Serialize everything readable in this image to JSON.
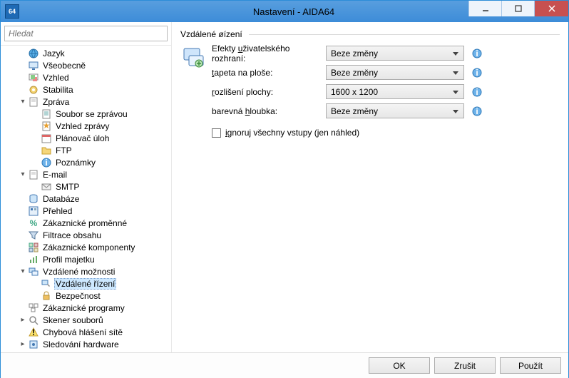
{
  "window": {
    "title": "Nastavení - AIDA64",
    "app_icon_text": "64"
  },
  "search": {
    "placeholder": "Hledat"
  },
  "tree": [
    {
      "label": "Jazyk",
      "icon": "globe",
      "indent": 1,
      "toggle": "none"
    },
    {
      "label": "Všeobecně",
      "icon": "monitor",
      "indent": 1,
      "toggle": "none"
    },
    {
      "label": "Vzhled",
      "icon": "palette",
      "indent": 1,
      "toggle": "none"
    },
    {
      "label": "Stabilita",
      "icon": "gear-yellow",
      "indent": 1,
      "toggle": "none"
    },
    {
      "label": "Zpráva",
      "icon": "page",
      "indent": 1,
      "toggle": "open"
    },
    {
      "label": "Soubor se zprávou",
      "icon": "page-lines",
      "indent": 2,
      "toggle": "none"
    },
    {
      "label": "Vzhled zprávy",
      "icon": "page-star",
      "indent": 2,
      "toggle": "none"
    },
    {
      "label": "Plánovač úloh",
      "icon": "calendar",
      "indent": 2,
      "toggle": "none"
    },
    {
      "label": "FTP",
      "icon": "folder",
      "indent": 2,
      "toggle": "none"
    },
    {
      "label": "Poznámky",
      "icon": "info-blue",
      "indent": 2,
      "toggle": "none"
    },
    {
      "label": "E-mail",
      "icon": "page",
      "indent": 1,
      "toggle": "open"
    },
    {
      "label": "SMTP",
      "icon": "envelope",
      "indent": 2,
      "toggle": "none"
    },
    {
      "label": "Databáze",
      "icon": "db",
      "indent": 1,
      "toggle": "none"
    },
    {
      "label": "Přehled",
      "icon": "summary",
      "indent": 1,
      "toggle": "none"
    },
    {
      "label": "Zákaznické proměnné",
      "icon": "vars",
      "indent": 1,
      "toggle": "none"
    },
    {
      "label": "Filtrace obsahu",
      "icon": "funnel",
      "indent": 1,
      "toggle": "none"
    },
    {
      "label": "Zákaznické komponenty",
      "icon": "components",
      "indent": 1,
      "toggle": "none"
    },
    {
      "label": "Profil majetku",
      "icon": "chart",
      "indent": 1,
      "toggle": "none"
    },
    {
      "label": "Vzdálené možnosti",
      "icon": "remote",
      "indent": 1,
      "toggle": "open"
    },
    {
      "label": "Vzdálené řízení",
      "icon": "remote-ctrl",
      "indent": 2,
      "toggle": "none",
      "selected": true
    },
    {
      "label": "Bezpečnost",
      "icon": "lock",
      "indent": 2,
      "toggle": "none"
    },
    {
      "label": "Zákaznické programy",
      "icon": "apps",
      "indent": 1,
      "toggle": "none"
    },
    {
      "label": "Skener souborů",
      "icon": "magnify",
      "indent": 1,
      "toggle": "closed"
    },
    {
      "label": "Chybová hlášení sítě",
      "icon": "warning",
      "indent": 1,
      "toggle": "none"
    },
    {
      "label": "Sledování hardware",
      "icon": "hw",
      "indent": 1,
      "toggle": "closed"
    }
  ],
  "panel": {
    "group_title": "Vzdálené øízení",
    "rows": [
      {
        "label_pre": "Efekty ",
        "label_u": "u",
        "label_post": "živatelského rozhraní:",
        "value": "Beze změny"
      },
      {
        "label_pre": "",
        "label_u": "t",
        "label_post": "apeta na ploše:",
        "value": "Beze změny"
      },
      {
        "label_pre": "",
        "label_u": "r",
        "label_post": "ozlišení plochy:",
        "value": "1600 x 1200"
      },
      {
        "label_pre": "barevná ",
        "label_u": "h",
        "label_post": "loubka:",
        "value": "Beze změny"
      }
    ],
    "checkbox_pre": "",
    "checkbox_u": "i",
    "checkbox_post": "gnoruj všechny vstupy (jen náhled)"
  },
  "footer": {
    "ok": "OK",
    "cancel": "Zrušit",
    "apply": "Použít"
  }
}
